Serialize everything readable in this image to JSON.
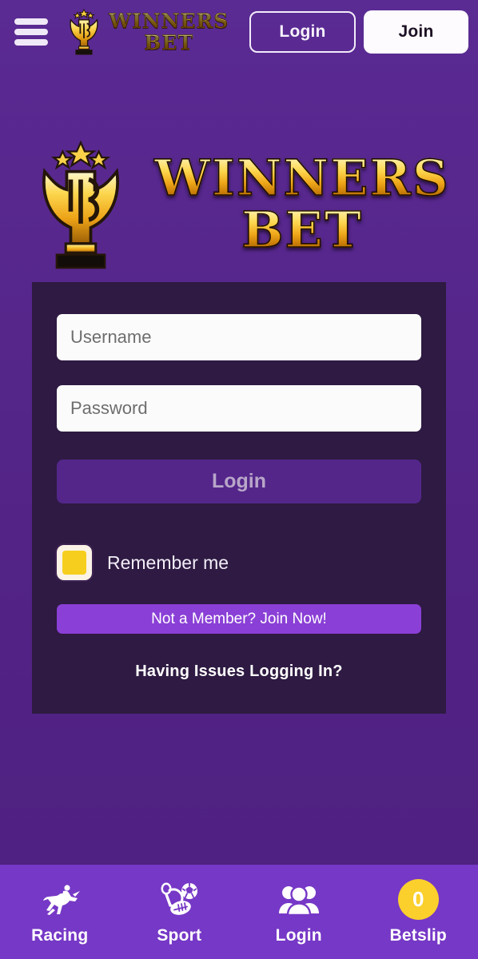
{
  "brand": {
    "name_line1": "WINNERS",
    "name_line2": "BET",
    "hero_line1": "WINNERS",
    "hero_line2": "BET",
    "colors": {
      "page_bg": "#522287",
      "header_bg": "#592a91",
      "card_bg": "#2e1a42",
      "accent_purple": "#8a3fd6",
      "nav_bg": "#7638c6",
      "gold": "#fbcf2c",
      "login_btn": "#54268a"
    }
  },
  "header": {
    "menu_icon": "hamburger-menu-icon",
    "login_label": "Login",
    "join_label": "Join"
  },
  "login_form": {
    "username_placeholder": "Username",
    "username_value": "",
    "password_placeholder": "Password",
    "password_value": "",
    "login_button_label": "Login",
    "remember_label": "Remember me",
    "remember_checked": true,
    "join_now_label": "Not a Member? Join Now!",
    "issues_label": "Having Issues Logging In?"
  },
  "bottom_nav": {
    "items": [
      {
        "label": "Racing",
        "icon": "horse-racing-icon"
      },
      {
        "label": "Sport",
        "icon": "sports-balls-icon"
      },
      {
        "label": "Login",
        "icon": "users-group-icon"
      },
      {
        "label": "Betslip",
        "icon": "betslip-count-badge",
        "count": "0"
      }
    ]
  }
}
